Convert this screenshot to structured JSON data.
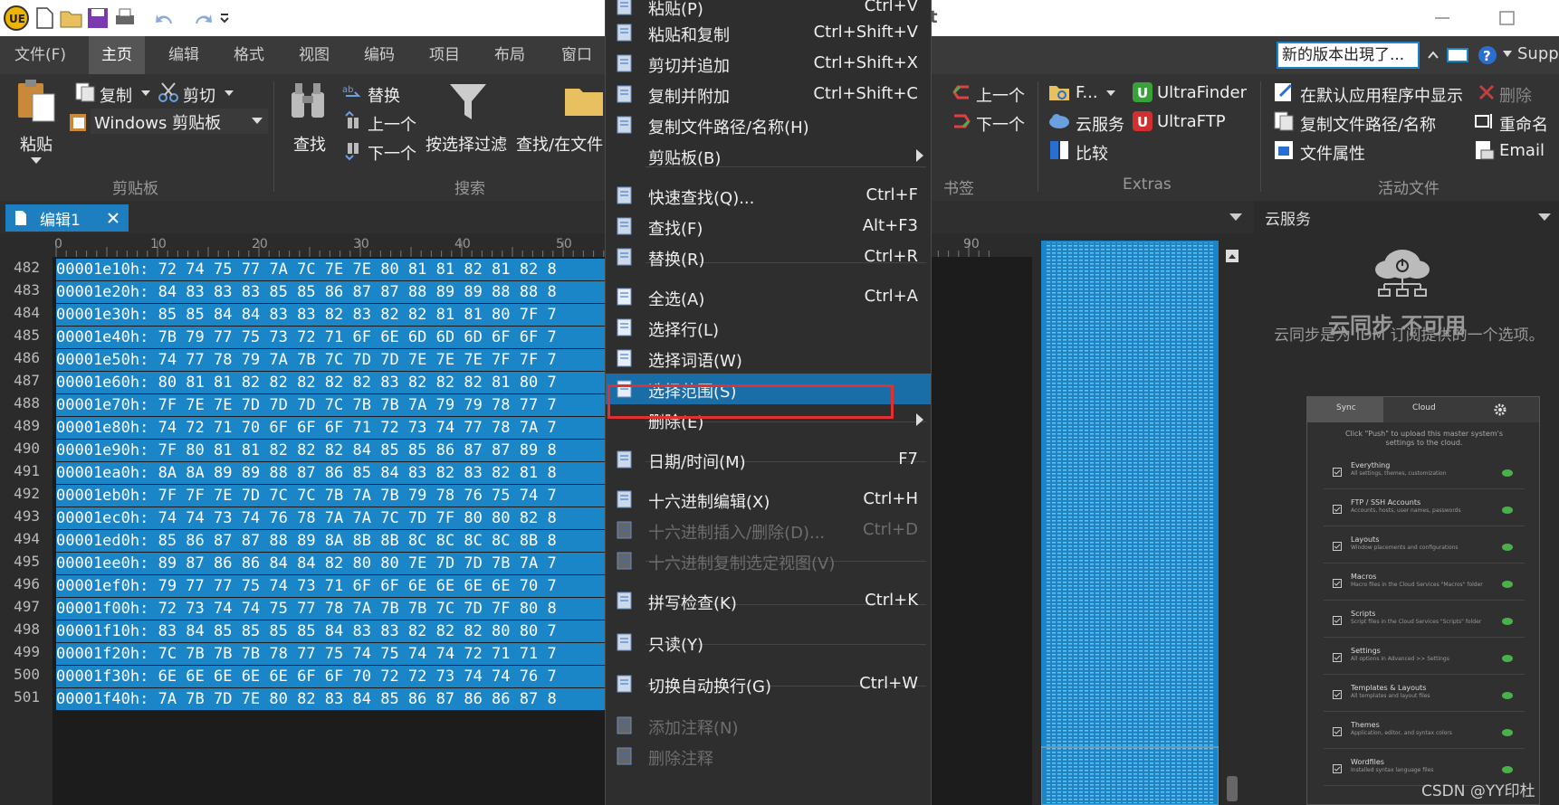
{
  "qat": {
    "partial_title": "it"
  },
  "menubar": {
    "items": [
      "文件(F)",
      "主页",
      "编辑",
      "格式",
      "视图",
      "编码",
      "项目",
      "布局",
      "窗口"
    ],
    "update_notice": "新的版本出現了...",
    "support": "Supp"
  },
  "ribbon": {
    "paste": "粘贴",
    "copy": "复制",
    "cut": "剪切",
    "clipboard": "Windows 剪贴板",
    "find": "查找",
    "replace": "替换",
    "prev": "上一个",
    "next": "下一个",
    "filter": "按选择过滤",
    "find_in_files": "查找/在文件",
    "bm_prev": "上一个",
    "bm_next": "下一个",
    "f_btn": "F...",
    "ultrafinder": "UltraFinder",
    "cloud": "云服务",
    "ultraftp": "UltraFTP",
    "compare": "比较",
    "show_default": "在默认应用程序中显示",
    "delete": "删除",
    "copy_path": "复制文件路径/名称",
    "rename": "重命名",
    "file_props": "文件属性",
    "email": "Email",
    "groups": {
      "clipboard": "剪贴板",
      "search": "搜索",
      "bookmarks": "书签",
      "extras": "Extras",
      "active_file": "活动文件"
    }
  },
  "editor": {
    "tab": "编辑1",
    "ruler": [
      "0",
      "10",
      "20",
      "30",
      "40",
      "50",
      "90"
    ],
    "lines": [
      {
        "n": "482",
        "t": "00001e10h: 72 74 75 77 7A 7C 7E 7E 80 81 81 82 81 82 8"
      },
      {
        "n": "483",
        "t": "00001e20h: 84 83 83 83 85 85 86 87 87 88 89 89 88 88 8"
      },
      {
        "n": "484",
        "t": "00001e30h: 85 85 84 84 83 83 82 83 82 82 81 81 80 7F 7"
      },
      {
        "n": "485",
        "t": "00001e40h: 7B 79 77 75 73 72 71 6F 6E 6D 6D 6D 6F 6F 7"
      },
      {
        "n": "486",
        "t": "00001e50h: 74 77 78 79 7A 7B 7C 7D 7D 7E 7E 7E 7F 7F 7"
      },
      {
        "n": "487",
        "t": "00001e60h: 80 81 81 82 82 82 82 82 83 82 82 82 81 80 7"
      },
      {
        "n": "488",
        "t": "00001e70h: 7F 7E 7E 7D 7D 7D 7C 7B 7B 7A 79 79 78 77 7"
      },
      {
        "n": "489",
        "t": "00001e80h: 74 72 71 70 6F 6F 6F 71 72 73 74 77 78 7A 7"
      },
      {
        "n": "490",
        "t": "00001e90h: 7F 80 81 81 82 82 82 84 85 85 86 87 87 89 8"
      },
      {
        "n": "491",
        "t": "00001ea0h: 8A 8A 89 89 88 87 86 85 84 83 82 83 82 81 8"
      },
      {
        "n": "492",
        "t": "00001eb0h: 7F 7F 7E 7D 7C 7C 7B 7A 7B 79 78 76 75 74 7"
      },
      {
        "n": "493",
        "t": "00001ec0h: 74 74 73 74 76 78 7A 7A 7C 7D 7F 80 80 82 8"
      },
      {
        "n": "494",
        "t": "00001ed0h: 85 86 87 87 88 89 8A 8B 8B 8C 8C 8C 8C 8B 8"
      },
      {
        "n": "495",
        "t": "00001ee0h: 89 87 86 86 84 84 82 80 80 7E 7D 7D 7B 7A 7"
      },
      {
        "n": "496",
        "t": "00001ef0h: 79 77 77 75 74 73 71 6F 6F 6E 6E 6E 6E 70 7"
      },
      {
        "n": "497",
        "t": "00001f00h: 72 73 74 74 75 77 78 7A 7B 7B 7C 7D 7F 80 8"
      },
      {
        "n": "498",
        "t": "00001f10h: 83 84 85 85 85 85 84 83 83 82 82 82 80 80 7"
      },
      {
        "n": "499",
        "t": "00001f20h: 7C 7B 7B 7B 78 77 75 74 75 74 74 72 71 71 7"
      },
      {
        "n": "500",
        "t": "00001f30h: 6E 6E 6E 6E 6E 6F 6F 70 72 72 73 74 74 76 7"
      },
      {
        "n": "501",
        "t": "00001f40h: 7A 7B 7D 7E 80 82 83 84 85 86 87 86 86 87 8"
      }
    ]
  },
  "menu": {
    "items": [
      {
        "label": "粘贴(P)",
        "shortcut": "Ctrl+V"
      },
      {
        "label": "粘贴和复制",
        "shortcut": "Ctrl+Shift+V"
      },
      {
        "label": "剪切并追加",
        "shortcut": "Ctrl+Shift+X"
      },
      {
        "label": "复制并附加",
        "shortcut": "Ctrl+Shift+C"
      },
      {
        "label": "复制文件路径/名称(H)",
        "shortcut": ""
      },
      {
        "label": "剪贴板(B)",
        "shortcut": ""
      },
      {
        "label": "快速查找(Q)...",
        "shortcut": "Ctrl+F"
      },
      {
        "label": "查找(F)",
        "shortcut": "Alt+F3"
      },
      {
        "label": "替换(R)",
        "shortcut": "Ctrl+R"
      },
      {
        "label": "全选(A)",
        "shortcut": "Ctrl+A"
      },
      {
        "label": "选择行(L)",
        "shortcut": ""
      },
      {
        "label": "选择词语(W)",
        "shortcut": ""
      },
      {
        "label": "选择范围(S)",
        "shortcut": ""
      },
      {
        "label": "删除(E)",
        "shortcut": ""
      },
      {
        "label": "日期/时间(M)",
        "shortcut": "F7"
      },
      {
        "label": "十六进制编辑(X)",
        "shortcut": "Ctrl+H"
      },
      {
        "label": "十六进制插入/删除(D)...",
        "shortcut": "Ctrl+D"
      },
      {
        "label": "十六进制复制选定视图(V)",
        "shortcut": ""
      },
      {
        "label": "拼写检查(K)",
        "shortcut": "Ctrl+K"
      },
      {
        "label": "只读(Y)",
        "shortcut": ""
      },
      {
        "label": "切换自动换行(G)",
        "shortcut": "Ctrl+W"
      },
      {
        "label": "添加注释(N)",
        "shortcut": ""
      },
      {
        "label": "删除注释",
        "shortcut": ""
      }
    ],
    "highlight_color": "#1a6ea8",
    "outline_color": "#e03030"
  },
  "cloud": {
    "header": "云服务",
    "title": "云同步 不可用",
    "desc": "云同步是为 IDM 订阅提供的一个选项。",
    "tabs": [
      "Sync",
      "Cloud"
    ],
    "hint": "Click \"Push\" to upload this master system's settings to the cloud.",
    "rows": [
      {
        "t": "Everything",
        "s": "All settings, themes, customization"
      },
      {
        "t": "FTP / SSH Accounts",
        "s": "Accounts, hosts, user names, passwords"
      },
      {
        "t": "Layouts",
        "s": "Window placements and configurations"
      },
      {
        "t": "Macros",
        "s": "Macro files in the Cloud Services \"Macros\" folder"
      },
      {
        "t": "Scripts",
        "s": "Script files in the Cloud Services \"Scripts\" folder"
      },
      {
        "t": "Settings",
        "s": "All options in Advanced >> Settings"
      },
      {
        "t": "Templates & Layouts",
        "s": "All templates and layout files"
      },
      {
        "t": "Themes",
        "s": "Application, editor, and syntax colors"
      },
      {
        "t": "Wordfiles",
        "s": "Installed syntax language files"
      }
    ]
  },
  "watermark": "CSDN @YY印杜"
}
